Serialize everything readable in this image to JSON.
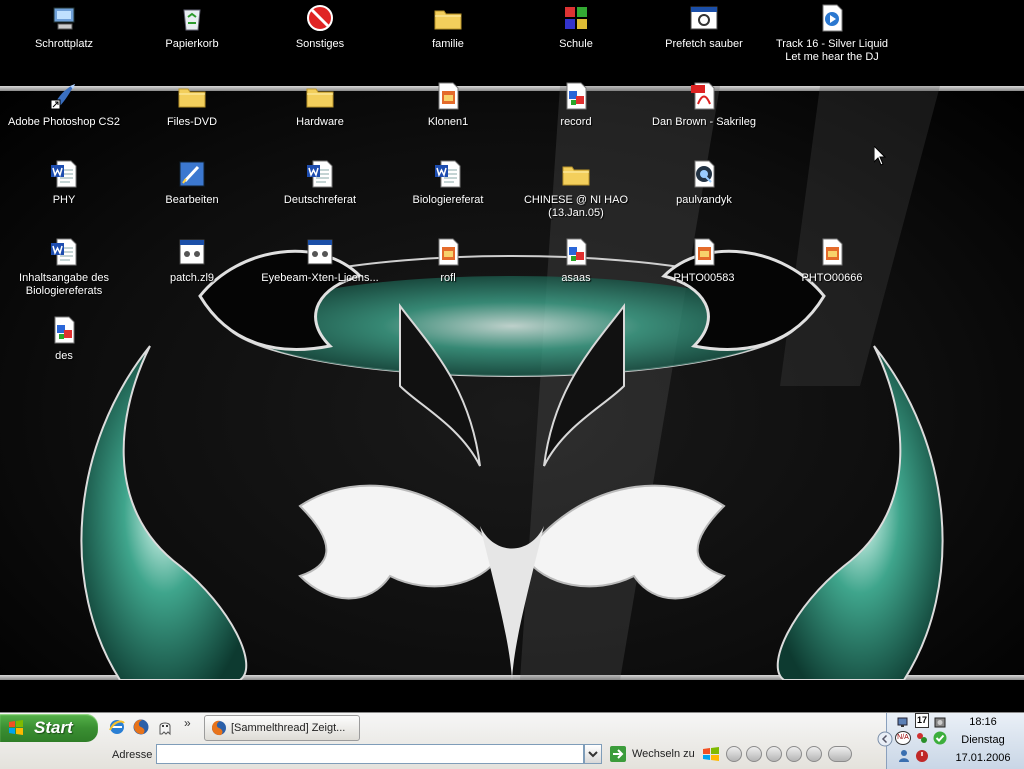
{
  "desktop": {
    "icons": [
      {
        "label": "Schrottplatz",
        "icon": "my-computer-icon"
      },
      {
        "label": "Papierkorb",
        "icon": "recycle-bin-icon"
      },
      {
        "label": "Sonstiges",
        "icon": "no-entry-icon"
      },
      {
        "label": "familie",
        "icon": "folder-icon"
      },
      {
        "label": "Schule",
        "icon": "program-icon"
      },
      {
        "label": "Prefetch sauber",
        "icon": "batch-file-icon"
      },
      {
        "label": "Track 16 - Silver Liquid Let me hear the DJ",
        "icon": "media-file-icon"
      },
      {
        "label": "Adobe Photoshop CS2",
        "icon": "photoshop-shortcut-icon"
      },
      {
        "label": "Files-DVD",
        "icon": "folder-icon"
      },
      {
        "label": "Hardware",
        "icon": "folder-icon"
      },
      {
        "label": "Klonen1",
        "icon": "image-file-icon"
      },
      {
        "label": "record",
        "icon": "paint-file-icon"
      },
      {
        "label": "Dan Brown - Sakrileg",
        "icon": "pdf-file-icon"
      },
      {
        "label": "PHY",
        "icon": "word-document-icon"
      },
      {
        "label": "Bearbeiten",
        "icon": "edit-shortcut-icon"
      },
      {
        "label": "Deutschreferat",
        "icon": "word-document-icon"
      },
      {
        "label": "Biologiereferat",
        "icon": "word-document-icon"
      },
      {
        "label": "CHINESE @ NI HAO (13.Jan.05)",
        "icon": "folder-icon"
      },
      {
        "label": "paulvandyk",
        "icon": "quicktime-file-icon"
      },
      {
        "label": "Inhaltsangabe des Biologiereferats",
        "icon": "word-document-icon"
      },
      {
        "label": "patch.zl9",
        "icon": "unknown-file-icon"
      },
      {
        "label": "Eyebeam-Xten-Licens...",
        "icon": "unknown-file-icon"
      },
      {
        "label": "rofl",
        "icon": "image-file-icon"
      },
      {
        "label": "asaas",
        "icon": "paint-file-icon"
      },
      {
        "label": "PHTO00583",
        "icon": "image-file-icon"
      },
      {
        "label": "PHTO00666",
        "icon": "image-file-icon"
      },
      {
        "label": "des",
        "icon": "paint-file-icon"
      }
    ]
  },
  "taskbar": {
    "start_label": "Start",
    "quick_launch": [
      "internet-explorer-icon",
      "firefox-icon",
      "ghost-app-icon"
    ],
    "overflow_glyph": "»",
    "task_button": "[Sammelthread] Zeigt...",
    "address_label": "Adresse",
    "address_value": "",
    "go_label": "Wechseln zu",
    "media_controls": [
      "previous-icon",
      "play-pause-icon",
      "stop-icon",
      "rewind-icon",
      "forward-icon",
      "volume-icon"
    ]
  },
  "tray": {
    "icons": [
      "network-icon",
      "calendar-icon",
      "speaker-icon",
      "na-badge-icon",
      "messenger-icon",
      "checkmark-icon",
      "collapse-arrow-icon",
      "user-icon",
      "power-icon"
    ],
    "calendar_day": "17",
    "na_text": "N/A",
    "time": "18:16",
    "day": "Dienstag",
    "date": "17.01.2006"
  },
  "colors": {
    "desktop_bg": "#000000",
    "start_green": "#3a8f32",
    "tray_bg": "#d8e2ee",
    "wallpaper_accent": "#3fa58c"
  }
}
